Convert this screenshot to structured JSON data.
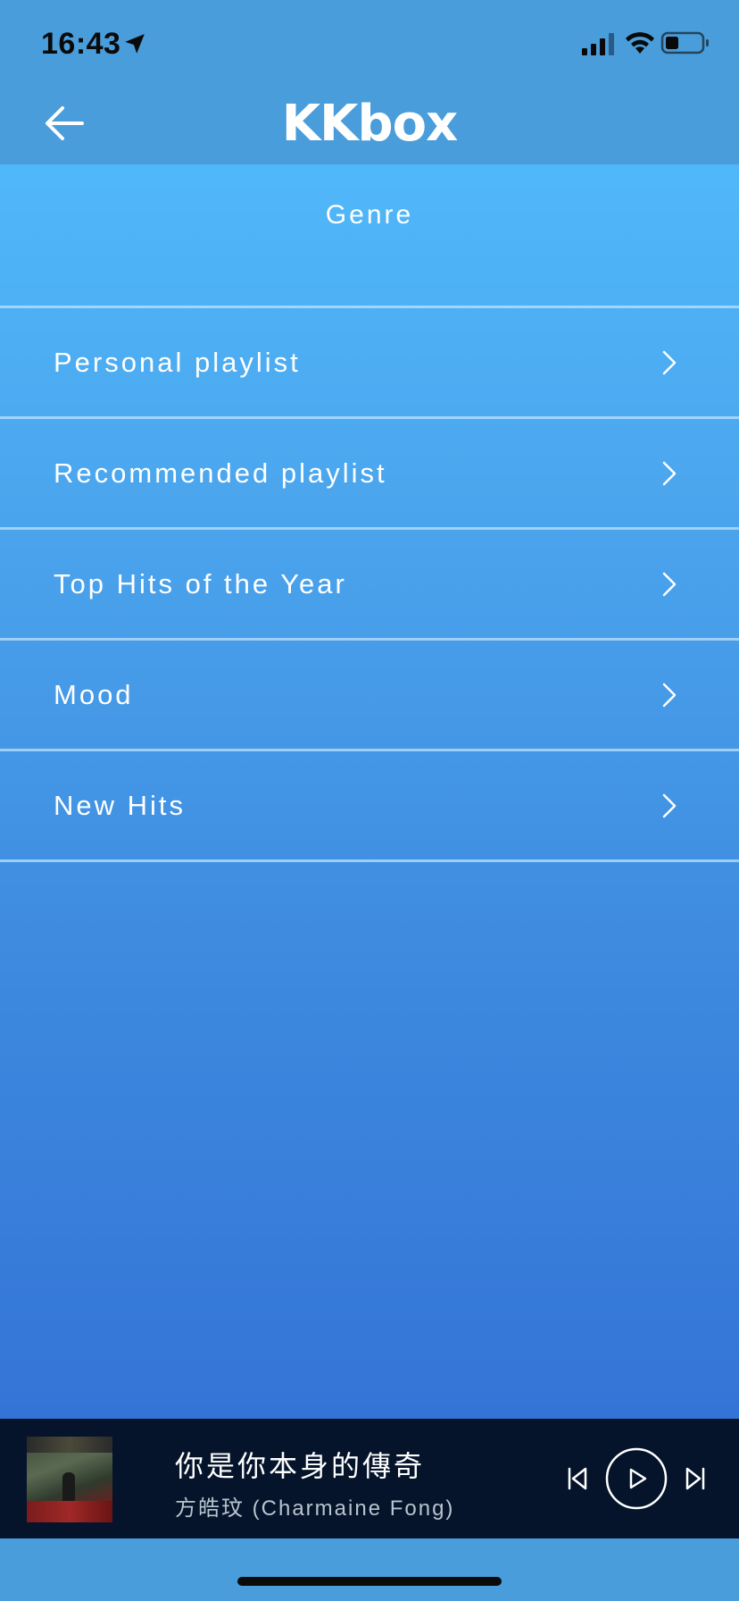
{
  "status_bar": {
    "time": "16:43"
  },
  "header": {
    "logo_text": "KKbox"
  },
  "main": {
    "section_title": "Genre",
    "menu_items": [
      {
        "label": "Personal playlist"
      },
      {
        "label": "Recommended playlist"
      },
      {
        "label": "Top Hits of the Year"
      },
      {
        "label": "Mood"
      },
      {
        "label": "New Hits"
      }
    ]
  },
  "player": {
    "track_title": "你是你本身的傳奇",
    "artist": "方皓玟 (Charmaine Fong)"
  },
  "icons": {
    "back": "back-arrow-icon",
    "chevron": "chevron-right-icon",
    "prev": "skip-previous-icon",
    "play": "play-icon",
    "next": "skip-next-icon"
  },
  "colors": {
    "header_bg": "#4a9ddb",
    "gradient_top": "#50b8fa",
    "gradient_bottom": "#3474d6",
    "player_bg": "#05142a"
  }
}
